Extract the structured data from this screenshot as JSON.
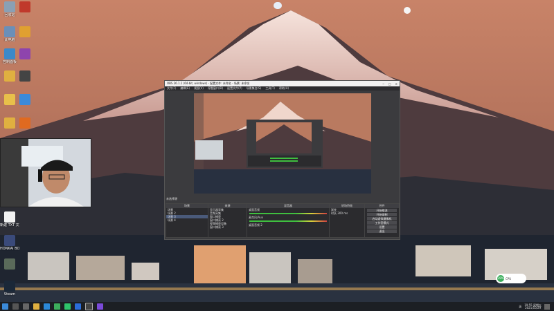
{
  "desktop": {
    "icons": [
      {
        "name": "recycle-bin-icon",
        "label": "回收站",
        "color": "#8aa0b4"
      },
      {
        "name": "app-icon-red",
        "label": "",
        "color": "#c0392b"
      },
      {
        "name": "computer-icon",
        "label": "此电脑",
        "color": "#6b8fb8"
      },
      {
        "name": "csgo-icon",
        "label": "",
        "color": "#e0a030"
      },
      {
        "name": "control-panel-icon",
        "label": "控制面板",
        "color": "#3b89c9"
      },
      {
        "name": "winrar-icon",
        "label": "",
        "color": "#8e44ad"
      },
      {
        "name": "folder-icon",
        "label": "",
        "color": "#e0b040"
      },
      {
        "name": "helmet-app-icon",
        "label": "",
        "color": "#444"
      },
      {
        "name": "folder-icon-2",
        "label": "",
        "color": "#e8c04a"
      },
      {
        "name": "bird-app-icon",
        "label": "",
        "color": "#3b8ad9"
      },
      {
        "name": "folder-icon-3",
        "label": "",
        "color": "#e0b040"
      },
      {
        "name": "orange-app-icon",
        "label": "",
        "color": "#e06a20"
      }
    ],
    "left_icons": [
      {
        "name": "text-file-icon",
        "label": "新建 TXT 文档",
        "color": "#f2f2f2"
      },
      {
        "name": "nvidia-app-icon",
        "label": "HONKAI BOT",
        "color": "#3a4a7a"
      },
      {
        "name": "game-icon",
        "label": "",
        "color": "#5a6a5a"
      },
      {
        "name": "steam-icon",
        "label": "Steam",
        "color": "#1b2838"
      }
    ]
  },
  "obs": {
    "title": "OBS 26.1.1 (64-bit, windows) - 配置文件: 未命名 - 场景: 未命名",
    "menu": [
      "文件(F)",
      "编辑(E)",
      "视图(V)",
      "停靠窗口(D)",
      "配置文件(P)",
      "场景集合(S)",
      "工具(T)",
      "帮助(H)"
    ],
    "scenes_header": "场景",
    "scenes": [
      "场景",
      "场景 2",
      "场景 3",
      "场景 4"
    ],
    "sources_header": "来源",
    "sources": [
      "显示器采集",
      "音频采集",
      "窗口捕获",
      "窗口捕获 2",
      "视频捕获设备",
      "窗口捕获 3"
    ],
    "mixer_header": "混音器",
    "mixer": [
      "桌面音频",
      "麦克风/Aux",
      "桌面音频 2"
    ],
    "transitions_header": "转场特效",
    "transition_value": "渐变",
    "duration_label": "时长",
    "duration_value": "300 ms",
    "controls_header": "控件",
    "controls": [
      "开始推流",
      "开始录制",
      "启动虚拟摄像机",
      "工作室模式",
      "设置",
      "退出"
    ],
    "status_left": "LIVE: 00:00:00",
    "status_right": "REC: 00:00:00  CPU: 2.1%, 60.00 fps"
  },
  "taskbar": {
    "time": "19:55 星期五",
    "date": "2021/10/29",
    "lang": "英",
    "icons": [
      "windows-start-icon",
      "search-icon",
      "task-view-icon",
      "file-explorer-icon",
      "edge-icon",
      "chrome-icon",
      "wechat-icon",
      "vscode-icon",
      "obs-taskbar-icon",
      "store-icon"
    ]
  },
  "badge": {
    "text": "29%",
    "label": "CPU"
  }
}
